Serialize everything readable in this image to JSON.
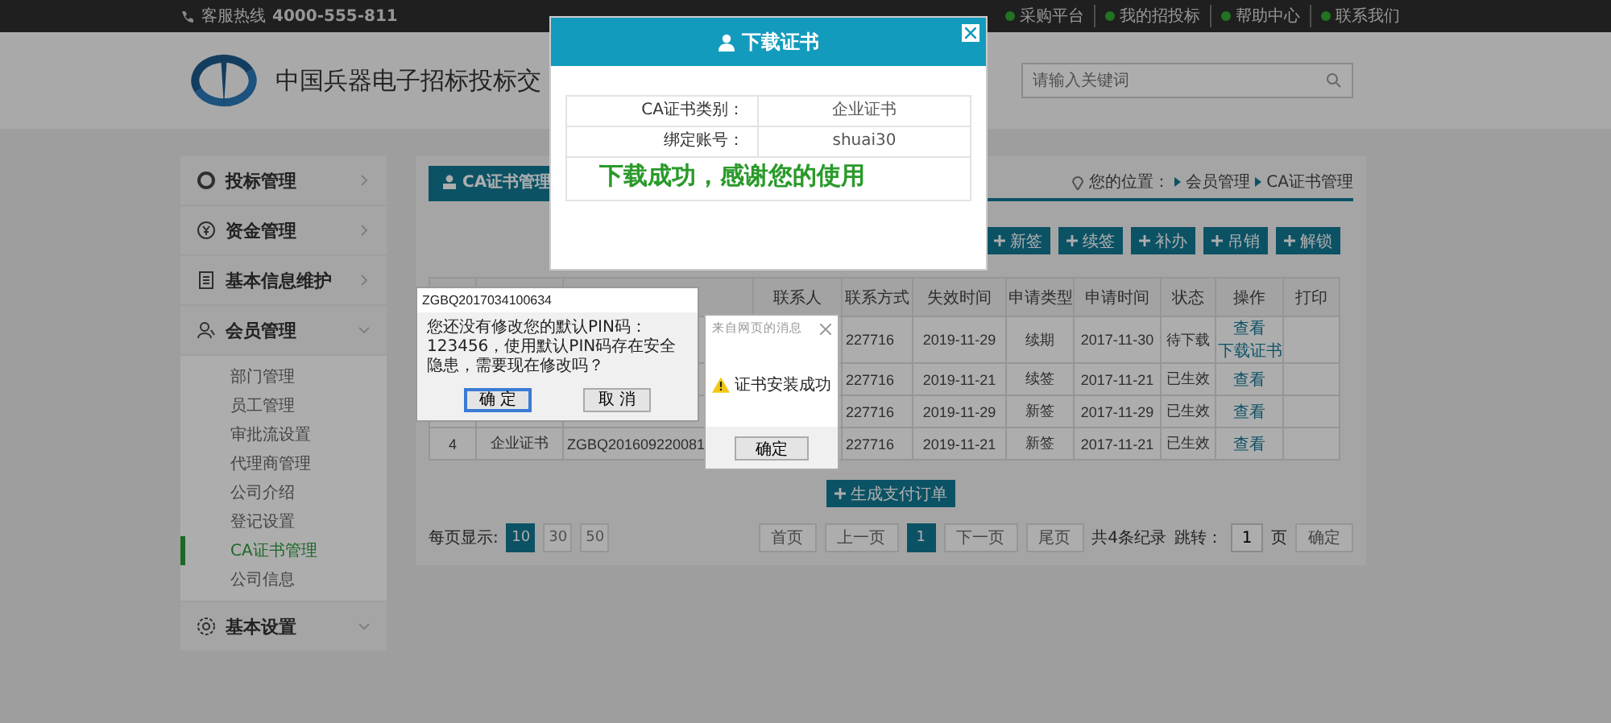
{
  "top_bar": {
    "hotline_label": "客服热线",
    "hotline": "4000-555-811",
    "links": [
      {
        "label": "采购平台"
      },
      {
        "label": "我的招投标"
      },
      {
        "label": "帮助中心"
      },
      {
        "label": "联系我们"
      }
    ]
  },
  "header": {
    "site_title": "中国兵器电子招标投标交",
    "search": {
      "placeholder": "请输入关键词"
    }
  },
  "sidebar": {
    "items": [
      {
        "label": "投标管理",
        "expanded": false
      },
      {
        "label": "资金管理",
        "expanded": false
      },
      {
        "label": "基本信息维护",
        "expanded": false
      },
      {
        "label": "会员管理",
        "expanded": true,
        "children": [
          {
            "label": "部门管理",
            "selected": false
          },
          {
            "label": "员工管理",
            "selected": false
          },
          {
            "label": "审批流设置",
            "selected": false
          },
          {
            "label": "代理商管理",
            "selected": false
          },
          {
            "label": "公司介绍",
            "selected": false
          },
          {
            "label": "登记设置",
            "selected": false
          },
          {
            "label": "CA证书管理",
            "selected": true
          },
          {
            "label": "公司信息",
            "selected": false
          }
        ]
      },
      {
        "label": "基本设置",
        "expanded": true
      }
    ]
  },
  "panel": {
    "tab": "CA证书管理",
    "breadcrumb": {
      "label": "您的位置：",
      "items": [
        "会员管理",
        "CA证书管理"
      ]
    },
    "actions": [
      "新签",
      "续签",
      "补办",
      "吊销",
      "解锁"
    ],
    "table": {
      "headers": {
        "contact": "联系人",
        "phone": "联系方式",
        "expires": "失效时间",
        "apply_type": "申请类型",
        "apply_time": "申请时间",
        "status": "状态",
        "operation": "操作",
        "print": "打印"
      },
      "rows": [
        {
          "phone": "227716",
          "expires": "2019-11-29",
          "apply_type": "续期",
          "apply_time": "2017-11-30",
          "status": "待下载",
          "operation": [
            "查看",
            "下载证书"
          ]
        },
        {
          "phone": "227716",
          "expires": "2019-11-21",
          "apply_type": "续签",
          "apply_time": "2017-11-21",
          "status": "已生效",
          "operation": [
            "查看"
          ]
        },
        {
          "phone": "227716",
          "expires": "2019-11-29",
          "apply_type": "新签",
          "apply_time": "2017-11-29",
          "status": "已生效",
          "operation": [
            "查看"
          ]
        },
        {
          "column_1": "4",
          "column_2": "企业证书",
          "column_3": "ZGBQ201609220081",
          "phone": "227716",
          "expires": "2019-11-21",
          "apply_type": "新签",
          "apply_time": "2017-11-21",
          "status": "已生效",
          "operation": [
            "查看"
          ]
        }
      ]
    },
    "generate_button": "生成支付订单",
    "pagination": {
      "page_size_label": "每页显示:",
      "page_sizes": [
        {
          "label": "10",
          "selected": true
        },
        {
          "label": "30",
          "selected": false
        },
        {
          "label": "50",
          "selected": false
        }
      ],
      "first": "首页",
      "prev": "上一页",
      "pages": [
        {
          "label": "1",
          "selected": true
        }
      ],
      "next": "下一页",
      "last": "尾页",
      "total": "共4条纪录",
      "jump_label": "跳转：",
      "jump_value": "1",
      "page_unit": "页",
      "confirm": "确定"
    }
  },
  "download_dialog": {
    "title": "下载证书",
    "rows": [
      {
        "label": "CA证书类别：",
        "value": "企业证书"
      },
      {
        "label": "绑定账号：",
        "value": "shuai30"
      }
    ],
    "message": "下载成功，感谢您的使用"
  },
  "pin_dialog": {
    "title": "ZGBQ2017034100634",
    "message": "您还没有修改您的默认PIN码：123456，使用默认PIN码存在安全隐患，需要现在修改吗？",
    "buttons": [
      {
        "label": "确 定",
        "focused": true
      },
      {
        "label": "取 消",
        "focused": false
      }
    ]
  },
  "alert_dialog": {
    "title": "来自网页的消息",
    "message": "证书安装成功",
    "button": "确定"
  }
}
